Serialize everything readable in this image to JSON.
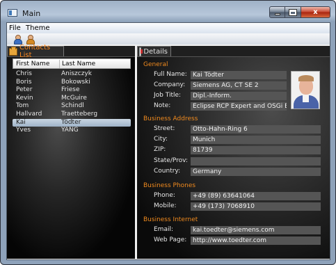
{
  "window": {
    "title": "Main",
    "close_glyph": "x"
  },
  "menu": {
    "file": "File",
    "theme": "Theme"
  },
  "toolbar": {
    "icons": [
      "person-icon",
      "person-add-icon"
    ]
  },
  "contacts": {
    "tab_label": "Contacts List",
    "columns": [
      "First Name",
      "Last Name"
    ],
    "rows": [
      {
        "first": "Chris",
        "last": "Aniszczyk"
      },
      {
        "first": "Boris",
        "last": "Bokowski"
      },
      {
        "first": "Peter",
        "last": "Friese"
      },
      {
        "first": "Kevin",
        "last": "McGuire"
      },
      {
        "first": "Tom",
        "last": "Schindl"
      },
      {
        "first": "Hallvard",
        "last": "Traetteberg"
      },
      {
        "first": "Kai",
        "last": "Tödter"
      },
      {
        "first": "Yves",
        "last": "YANG"
      }
    ],
    "selected_index": 6
  },
  "details": {
    "tab_label": "Details",
    "general": {
      "title": "General",
      "full_name_label": "Full Name:",
      "full_name": "Kai Tödter",
      "company_label": "Company:",
      "company": "Siemens AG, CT SE 2",
      "job_title_label": "Job Title:",
      "job_title": "Dipl.-Inform.",
      "note_label": "Note:",
      "note": "Eclipse RCP Expert and OSGi Er"
    },
    "address": {
      "title": "Business Address",
      "street_label": "Street:",
      "street": "Otto-Hahn-Ring 6",
      "city_label": "City:",
      "city": "Munich",
      "zip_label": "ZIP:",
      "zip": "81739",
      "state_label": "State/Prov:",
      "state": "",
      "country_label": "Country:",
      "country": "Germany"
    },
    "phones": {
      "title": "Business Phones",
      "phone_label": "Phone:",
      "phone": "+49 (89) 63641064",
      "mobile_label": "Mobile:",
      "mobile": "+49 (173) 7068910"
    },
    "internet": {
      "title": "Business Internet",
      "email_label": "Email:",
      "email": "kai.toedter@siemens.com",
      "web_label": "Web Page:",
      "web": "http://www.toedter.com"
    }
  },
  "colors": {
    "accent": "#f08a1e",
    "selection": "#b3c4d6",
    "field_bg": "#555555"
  }
}
